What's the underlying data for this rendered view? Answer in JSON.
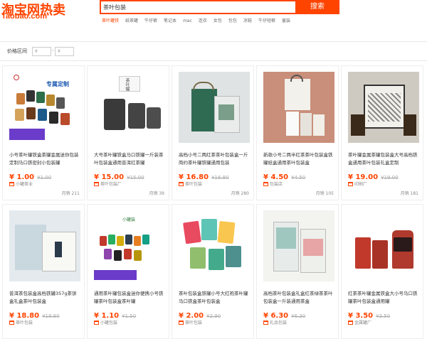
{
  "header": {
    "logo_main": "淘宝网热卖",
    "logo_sub": "Taobao.com",
    "search_value": "茶叶包装",
    "search_button": "搜索",
    "hotwords": [
      "茶叶罐铁",
      "纸茶罐",
      "牛仔裤",
      "笔记本",
      "mac",
      "连衣",
      "女包",
      "包包",
      "凉鞋",
      "牛仔短裤",
      "童装"
    ]
  },
  "filter": {
    "label": "价格区间",
    "min_placeholder": "¥",
    "max_placeholder": "¥",
    "dash": "-"
  },
  "products": [
    {
      "title": "小号茶叶罐铁盒茶罐金属迷你包装定制马口铁密封小包装罐",
      "price": "¥ 1.00",
      "orig": "¥1.00",
      "shop": "小罐茶业",
      "sales": "月销 211",
      "badge": "专属定制"
    },
    {
      "title": "大号茶叶罐铁盒马口铁罐一斤装茶叶包装盒通用普洱红茶罐",
      "price": "¥ 15.00",
      "orig": "¥15.00",
      "shop": "茶叶包装厂",
      "sales": "月销 39",
      "badge": "茶叶罐"
    },
    {
      "title": "高档小号二两红茶茶叶包装盒一斤简约茶叶罐铁罐通用包装",
      "price": "¥ 16.80",
      "orig": "¥16.80",
      "shop": "茶叶包装",
      "sales": "月销 280",
      "badge": ""
    },
    {
      "title": "新款小号二两半红茶茶叶包装盒铁罐纸盒通用茶叶包装盒",
      "price": "¥ 4.50",
      "orig": "¥4.50",
      "shop": "包装店",
      "sales": "月销 105",
      "badge": ""
    },
    {
      "title": "茶叶罐金属茶罐包装盒大号高档铁盒通用茶叶包装礼盒定制",
      "price": "¥ 19.00",
      "orig": "¥19.00",
      "shop": "印刷厂",
      "sales": "月销 181",
      "badge": ""
    },
    {
      "title": "普洱茶包装盒高档铁罐357g茶饼盒礼盒茶叶包装盒",
      "price": "¥ 18.80",
      "orig": "¥18.80",
      "shop": "茶叶包装",
      "sales": "",
      "badge": ""
    },
    {
      "title": "通用茶叶罐包装盒迷你便携小号铁罐茶叶包装盒茶叶罐",
      "price": "¥ 1.10",
      "orig": "¥1.50",
      "shop": "小罐包装",
      "sales": "",
      "badge": "小罐装"
    },
    {
      "title": "茶叶包装盒铁罐小号大红袍茶叶罐马口铁盒茶叶包装盒",
      "price": "¥ 2.00",
      "orig": "¥2.90",
      "shop": "茶叶包装",
      "sales": "",
      "badge": ""
    },
    {
      "title": "高档茶叶包装盒礼盒红茶绿茶茶叶包装盒一斤装通用茶盒",
      "price": "¥ 6.30",
      "orig": "¥6.30",
      "shop": "礼品包装",
      "sales": "",
      "badge": ""
    },
    {
      "title": "红茶茶叶罐金属铁盒大小号马口铁罐茶叶包装盒通用罐",
      "price": "¥ 3.50",
      "orig": "¥3.50",
      "shop": "金属罐厂",
      "sales": "",
      "badge": ""
    }
  ]
}
